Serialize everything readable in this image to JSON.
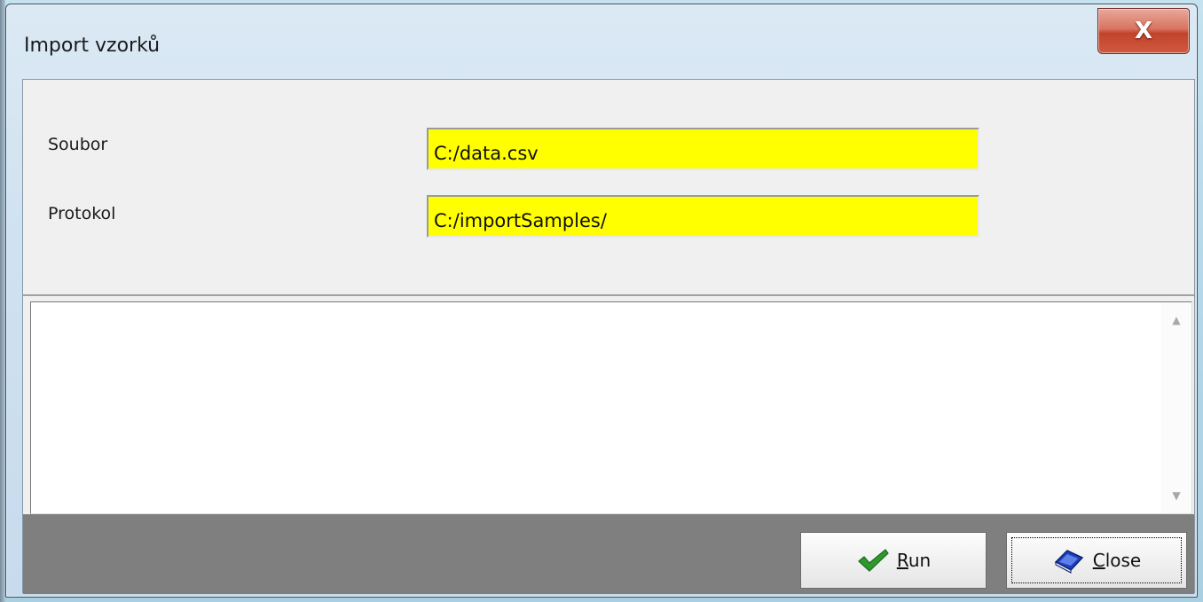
{
  "window": {
    "title": "Import vzorků",
    "close_glyph": "X"
  },
  "form": {
    "file_label": "Soubor",
    "file_value": "C:/data.csv",
    "protocol_label": "Protokol",
    "protocol_value": "C:/importSamples/",
    "field_color": "#ffff00"
  },
  "log": {
    "content": "",
    "scroll_up_glyph": "▲",
    "scroll_down_glyph": "▼"
  },
  "buttons": {
    "run_mnemonic": "R",
    "run_rest": "un",
    "run_icon": "checkmark-icon",
    "close_mnemonic": "C",
    "close_rest": "lose",
    "close_icon": "book-icon"
  },
  "colors": {
    "button_bar": "#7f7f7f",
    "title_close": "#c2432c"
  }
}
